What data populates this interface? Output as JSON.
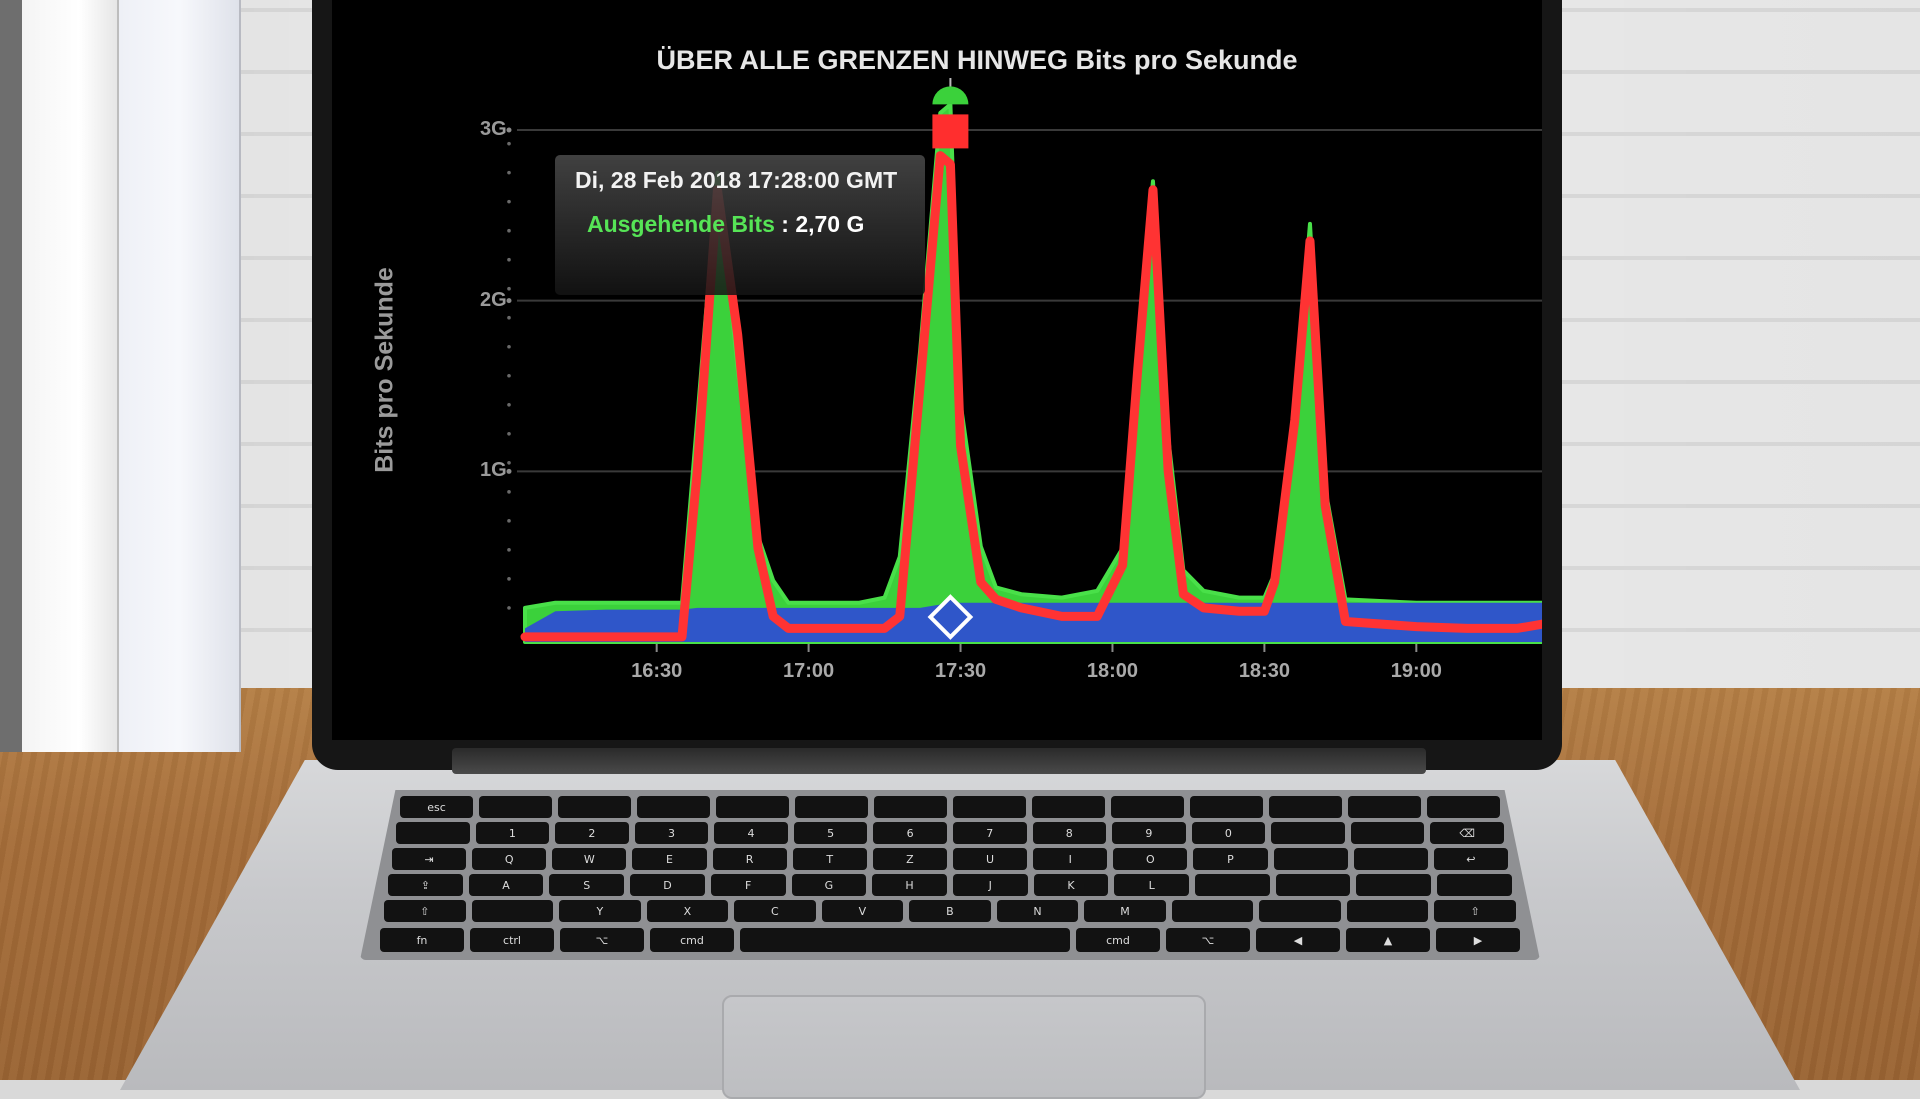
{
  "chart_data": {
    "type": "area",
    "title": "ÜBER ALLE GRENZEN HINWEG Bits pro Sekunde",
    "ylabel": "Bits pro Sekunde",
    "xlabel": "",
    "y_ticks": [
      "1G",
      "2G",
      "3G"
    ],
    "x_ticks": [
      "16:30",
      "17:00",
      "17:30",
      "18:00",
      "18:30",
      "19:00"
    ],
    "ylim": [
      0,
      3000000000
    ],
    "xlim": [
      "16:04",
      "19:26"
    ],
    "grid": true,
    "x": [
      "16:04",
      "16:10",
      "16:20",
      "16:30",
      "16:35",
      "16:38",
      "16:42",
      "16:46",
      "16:50",
      "16:53",
      "16:56",
      "17:00",
      "17:10",
      "17:15",
      "17:18",
      "17:22",
      "17:26",
      "17:28",
      "17:30",
      "17:34",
      "17:37",
      "17:42",
      "17:50",
      "17:57",
      "18:02",
      "18:05",
      "18:08",
      "18:11",
      "18:14",
      "18:18",
      "18:25",
      "18:30",
      "18:32",
      "18:36",
      "18:39",
      "18:42",
      "18:46",
      "19:00",
      "19:10",
      "19:20",
      "19:26"
    ],
    "series": [
      {
        "name": "Ausgehende Bits",
        "color": "#3bd13b",
        "values": [
          200000000,
          230000000,
          230000000,
          230000000,
          230000000,
          1300000000,
          2750000000,
          1600000000,
          620000000,
          360000000,
          230000000,
          230000000,
          230000000,
          260000000,
          500000000,
          1700000000,
          3100000000,
          3150000000,
          1400000000,
          560000000,
          320000000,
          280000000,
          260000000,
          300000000,
          550000000,
          1700000000,
          2700000000,
          1200000000,
          420000000,
          300000000,
          260000000,
          260000000,
          400000000,
          1350000000,
          2450000000,
          900000000,
          250000000,
          230000000,
          230000000,
          230000000,
          230000000
        ]
      },
      {
        "name": "",
        "color": "#2f56c9",
        "values": [
          80000000,
          180000000,
          190000000,
          190000000,
          190000000,
          200000000,
          200000000,
          200000000,
          200000000,
          200000000,
          200000000,
          200000000,
          200000000,
          200000000,
          200000000,
          200000000,
          220000000,
          230000000,
          230000000,
          230000000,
          230000000,
          230000000,
          230000000,
          230000000,
          230000000,
          230000000,
          230000000,
          230000000,
          230000000,
          230000000,
          230000000,
          230000000,
          230000000,
          230000000,
          230000000,
          230000000,
          230000000,
          230000000,
          230000000,
          230000000,
          230000000
        ]
      },
      {
        "name": "",
        "color": "#ff3333",
        "values": [
          30000000,
          30000000,
          30000000,
          30000000,
          30000000,
          1000000000,
          2650000000,
          1800000000,
          550000000,
          150000000,
          80000000,
          80000000,
          80000000,
          80000000,
          150000000,
          1500000000,
          2850000000,
          2800000000,
          1150000000,
          350000000,
          250000000,
          200000000,
          150000000,
          150000000,
          450000000,
          1600000000,
          2650000000,
          1000000000,
          280000000,
          200000000,
          180000000,
          180000000,
          350000000,
          1300000000,
          2350000000,
          800000000,
          120000000,
          90000000,
          80000000,
          80000000,
          110000000
        ]
      }
    ],
    "marker": {
      "x": "17:28",
      "y": 3150000000,
      "series": "Ausgehende Bits"
    },
    "crosshair_x": "17:28"
  },
  "tooltip": {
    "date": "Di, 28 Feb 2018 17:28:00 GMT",
    "series_label": "Ausgehende Bits",
    "separator": ":",
    "value": "2,70 G"
  },
  "keyboard": {
    "rows": [
      [
        "esc",
        "",
        "",
        "",
        "",
        "",
        "",
        "",
        "",
        "",
        "",
        "",
        "",
        ""
      ],
      [
        "",
        "1",
        "2",
        "3",
        "4",
        "5",
        "6",
        "7",
        "8",
        "9",
        "0",
        "",
        "",
        "⌫"
      ],
      [
        "⇥",
        "Q",
        "W",
        "E",
        "R",
        "T",
        "Z",
        "U",
        "I",
        "O",
        "P",
        "",
        "",
        "↩"
      ],
      [
        "⇪",
        "A",
        "S",
        "D",
        "F",
        "G",
        "H",
        "J",
        "K",
        "L",
        "",
        "",
        "",
        ""
      ],
      [
        "⇧",
        "",
        "Y",
        "X",
        "C",
        "V",
        "B",
        "N",
        "M",
        "",
        "",
        "",
        "⇧"
      ],
      [
        "fn",
        "ctrl",
        "⌥",
        "cmd",
        "",
        "cmd",
        "⌥",
        "◀",
        "▲",
        "▶"
      ]
    ]
  }
}
